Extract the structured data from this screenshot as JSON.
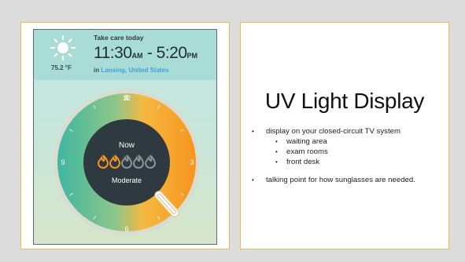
{
  "colors": {
    "panel_border": "#f0b85a",
    "uv_orange": "#f7941d",
    "uv_green": "#3fb6a0",
    "link_blue": "#3aa3d2"
  },
  "phone": {
    "header_title": "Take care today",
    "start_time": "11:30",
    "start_period": "AM",
    "separator": " - ",
    "end_time": "5:20",
    "end_period": "PM",
    "temperature": "75.2 °F",
    "location_prefix": "in",
    "location": "Lansing, United States",
    "dial": {
      "hour_labels": [
        "12",
        "3",
        "6",
        "9"
      ],
      "now_label": "Now",
      "level_label": "Moderate",
      "uv_icons_filled": 2,
      "uv_icons_total": 5,
      "icon_name": "flame-icon"
    }
  },
  "slide": {
    "title": "UV Light Display",
    "bullets": [
      {
        "text": "display  on your closed-circuit TV system",
        "sub": [
          "waiting  area",
          "exam rooms",
          "front desk"
        ]
      },
      {
        "text": "talking point for how sunglasses are needed.",
        "sub": []
      }
    ]
  }
}
